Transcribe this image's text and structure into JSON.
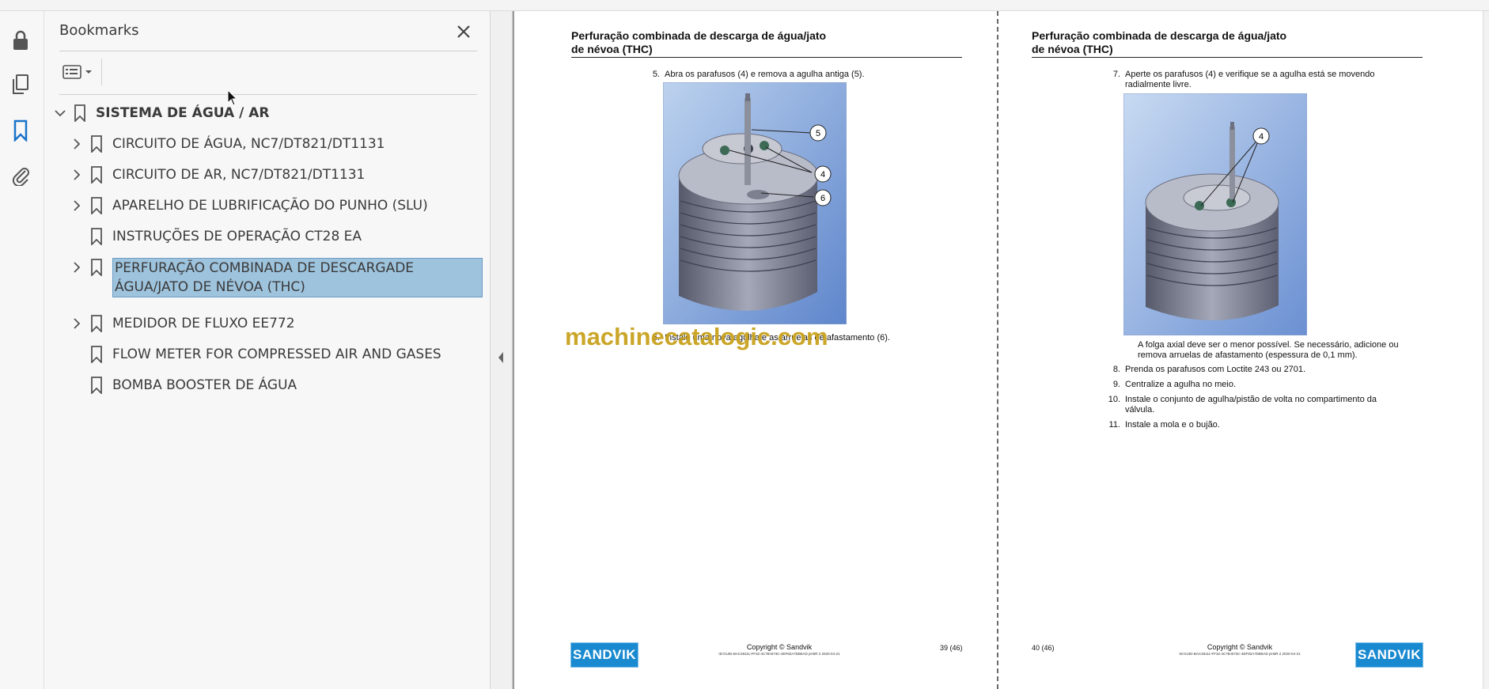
{
  "panel": {
    "title": "Bookmarks"
  },
  "bookmarks": [
    {
      "label": "SISTEMA DE ÁGUA / AR",
      "level": 0,
      "expandable": true,
      "expanded": true
    },
    {
      "label": "CIRCUITO DE ÁGUA, NC7/DT821/DT1131",
      "level": 1,
      "expandable": true
    },
    {
      "label": "CIRCUITO DE AR, NC7/DT821/DT1131",
      "level": 1,
      "expandable": true
    },
    {
      "label": "APARELHO DE LUBRIFICAÇÃO DO PUNHO (SLU)",
      "level": 1,
      "expandable": true
    },
    {
      "label": "INSTRUÇÕES DE OPERAÇÃO CT28 EA",
      "level": 1,
      "expandable": false
    },
    {
      "label": "PERFURAÇÃO COMBINADA DE DESCARGADE ÁGUA/JATO DE NÉVOA (THC)",
      "level": 1,
      "expandable": true,
      "selected": true
    },
    {
      "label": "MEDIDOR DE FLUXO EE772",
      "level": 1,
      "expandable": true
    },
    {
      "label": "FLOW METER FOR COMPRESSED AIR AND GASES",
      "level": 1,
      "expandable": false
    },
    {
      "label": "BOMBA BOOSTER DE ÁGUA",
      "level": 1,
      "expandable": false
    }
  ],
  "page_left": {
    "heading_line1": "Perfuração combinada de descarga de água/jato",
    "heading_line2": "de névoa (THC)",
    "step5_num": "5.",
    "step5_text": "Abra os parafusos (4) e remova a agulha antiga (5).",
    "callout_5": "5",
    "callout_4": "4",
    "callout_6": "6",
    "step6_num": "6.",
    "step6_text": "Instale uma nova agulha e as arruelas de afastamento (6).",
    "copyright": "Copyright © Sandvik",
    "doc_id": "ID:GUID-BAC48111-FF32-4C7B-B73C-4EF82A7DB6AD pt-BR 2 2020-04-21",
    "page_number": "39 (46)",
    "logo": "SANDVIK"
  },
  "page_right": {
    "heading_line1": "Perfuração combinada de descarga de água/jato",
    "heading_line2": "de névoa (THC)",
    "step7_num": "7.",
    "step7_text": "Aperte os parafusos (4) e verifique se a agulha está se movendo radialmente livre.",
    "callout_4": "4",
    "note": "A folga axial deve ser o menor possível. Se necessário, adicione ou remova arruelas de afastamento (espessura de 0,1 mm).",
    "step8_num": "8.",
    "step8_text": "Prenda os parafusos com Loctite 243 ou 2701.",
    "step9_num": "9.",
    "step9_text": "Centralize a agulha no meio.",
    "step10_num": "10.",
    "step10_text": "Instale o conjunto de agulha/pistão de volta no compartimento da válvula.",
    "step11_num": "11.",
    "step11_text": "Instale a mola e o bujão.",
    "copyright": "Copyright © Sandvik",
    "doc_id": "ID:GUID-BAC48111-FF32-4C7B-B73C-4EF82A7DB6AD pt-BR 2 2020-04-21",
    "page_number": "40 (46)",
    "logo": "SANDVIK"
  },
  "watermark": "machinecatalogic.com",
  "colors": {
    "selection": "#9ec3dd",
    "active_tool": "#1a73c9",
    "brand": "#1a8ad0",
    "watermark": "#c9a21e"
  }
}
